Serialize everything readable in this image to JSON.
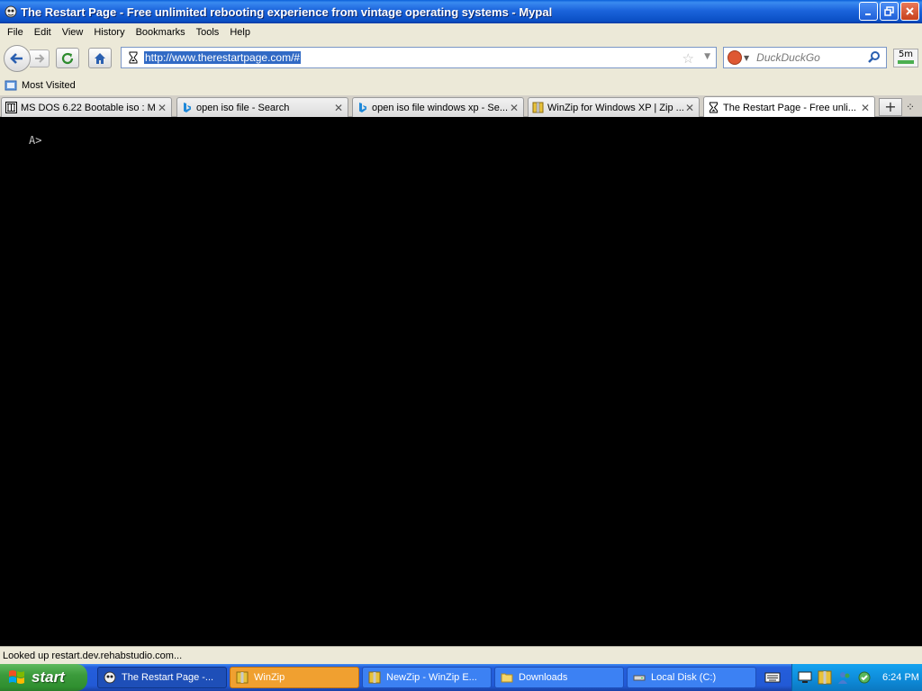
{
  "window": {
    "title": "The Restart Page - Free unlimited rebooting experience from vintage operating systems - Mypal",
    "controls": [
      "minimize",
      "maximize",
      "close"
    ]
  },
  "menu": {
    "items": [
      "File",
      "Edit",
      "View",
      "History",
      "Bookmarks",
      "Tools",
      "Help"
    ]
  },
  "nav": {
    "url": "http://www.therestartpage.com/#",
    "search_placeholder": "DuckDuckGo",
    "addon_label": "5m"
  },
  "bookmarks": {
    "items": [
      {
        "label": "Most Visited",
        "icon": "bookmarks-folder-icon"
      }
    ]
  },
  "tabs": [
    {
      "label": "MS DOS 6.22 Bootable iso : M...",
      "icon": "archive-org-icon",
      "active": false
    },
    {
      "label": "open iso file - Search",
      "icon": "bing-icon",
      "active": false
    },
    {
      "label": "open iso file windows xp - Se...",
      "icon": "bing-icon",
      "active": false
    },
    {
      "label": "WinZip for Windows XP | Zip ...",
      "icon": "winzip-icon",
      "active": false
    },
    {
      "label": "The Restart Page - Free unli...",
      "icon": "hourglass-icon",
      "active": true
    }
  ],
  "content": {
    "prompt": "A>"
  },
  "status": {
    "text": "Looked up restart.dev.rehabstudio.com..."
  },
  "taskbar": {
    "start_label": "start",
    "tasks": [
      {
        "label": "The Restart Page -...",
        "icon": "mypal-icon",
        "state": "active"
      },
      {
        "label": "WinZip",
        "icon": "winzip-icon",
        "state": "flash"
      },
      {
        "label": "NewZip - WinZip E...",
        "icon": "winzip-icon",
        "state": "normal"
      },
      {
        "label": "Downloads",
        "icon": "folder-icon",
        "state": "normal"
      },
      {
        "label": "Local Disk (C:)",
        "icon": "drive-icon",
        "state": "normal"
      }
    ],
    "clock": "6:24 PM"
  },
  "colors": {
    "taskbar_blue": "#245edb",
    "start_green": "#3c9b3c",
    "content_bg": "#000000",
    "selection": "#316ac5"
  }
}
